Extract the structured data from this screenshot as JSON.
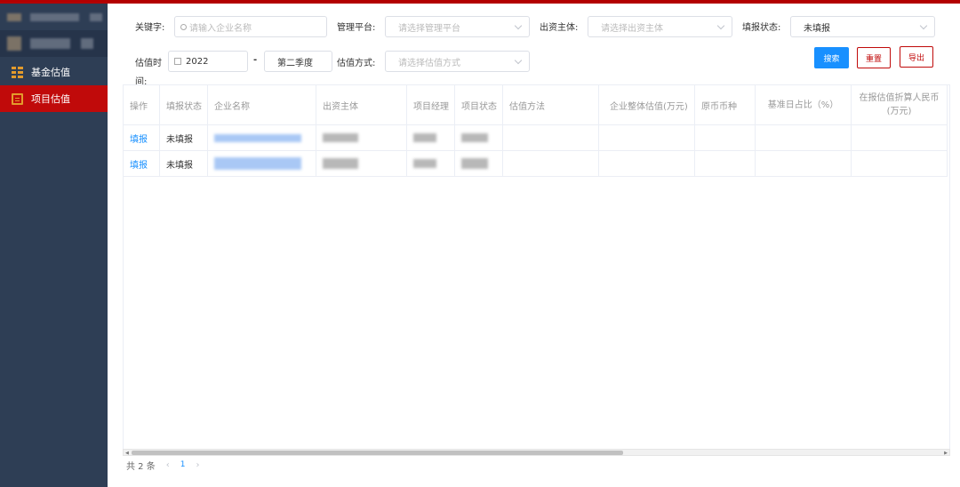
{
  "colors": {
    "sidebar_bg": "#2e3e55",
    "active_red": "#c00a0a",
    "accent_blue": "#1890ff",
    "icon_orange": "#e39b2c"
  },
  "sidebar": {
    "items": [
      {
        "label": "基金估值",
        "icon": "grid-icon",
        "active": false
      },
      {
        "label": "项目估值",
        "icon": "document-icon",
        "active": true
      }
    ]
  },
  "filters": {
    "keyword": {
      "label": "关键字:",
      "placeholder": "请输入企业名称"
    },
    "platform": {
      "label": "管理平台:",
      "placeholder": "请选择管理平台"
    },
    "investor": {
      "label": "出资主体:",
      "placeholder": "请选择出资主体"
    },
    "status": {
      "label": "填报状态:",
      "value": "未填报"
    },
    "time": {
      "label": "估值时间:",
      "year": "2022",
      "separator": "-",
      "quarter": "第二季度"
    },
    "method": {
      "label": "估值方式:",
      "placeholder": "请选择估值方式"
    }
  },
  "buttons": {
    "search": "搜索",
    "reset": "重置",
    "export": "导出"
  },
  "table": {
    "columns": [
      "操作",
      "填报状态",
      "企业名称",
      "出资主体",
      "项目经理",
      "项目状态",
      "估值方法",
      "企业整体估值(万元)",
      "原币币种",
      "基准日占比（%）",
      "在报估值折算人民币(万元)"
    ],
    "rows": [
      {
        "action": "填报",
        "status": "未填报"
      },
      {
        "action": "填报",
        "status": "未填报"
      }
    ]
  },
  "pagination": {
    "total": "共 2 条",
    "current": "1",
    "prev": "‹",
    "next": "›"
  }
}
